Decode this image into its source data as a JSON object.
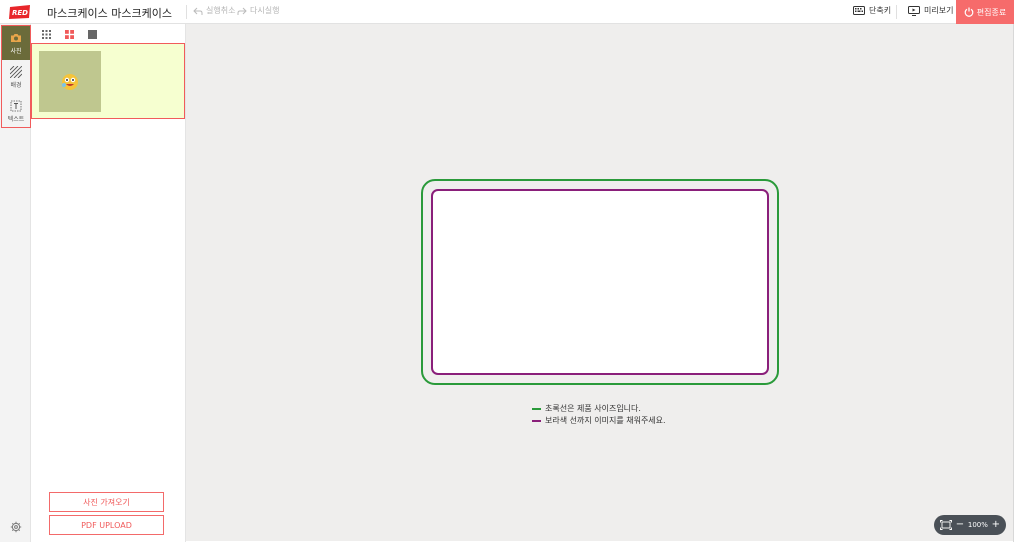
{
  "header": {
    "logo_text": "RED",
    "title": "마스크케이스 마스크케이스",
    "undo_label": "실행취소",
    "redo_label": "다시실행",
    "shortcut_label": "단축키",
    "preview_label": "미리보기",
    "finish_label": "편집종료",
    "finish_color": "#f66b6b"
  },
  "rail": {
    "items": [
      {
        "label": "사진",
        "icon": "camera-icon",
        "active": true
      },
      {
        "label": "배경",
        "icon": "background-pattern-icon",
        "active": false
      },
      {
        "label": "텍스트",
        "icon": "text-box-icon",
        "active": false
      }
    ],
    "settings_icon": "gear-icon"
  },
  "panel": {
    "view_modes": [
      "grid-small-icon",
      "grid-large-icon",
      "single-view-icon"
    ],
    "active_view": "grid-large-icon",
    "import_button": "사진 가져오기",
    "pdf_button": "PDF UPLOAD"
  },
  "canvas": {
    "legend": [
      {
        "color": "#2a9a3a",
        "text": "초록선은 제품 사이즈입니다."
      },
      {
        "color": "#8a1f7a",
        "text": "보라색 선까지 이미지를 채워주세요."
      }
    ]
  },
  "zoom": {
    "level": "100%",
    "minus": "−",
    "plus": "+"
  }
}
